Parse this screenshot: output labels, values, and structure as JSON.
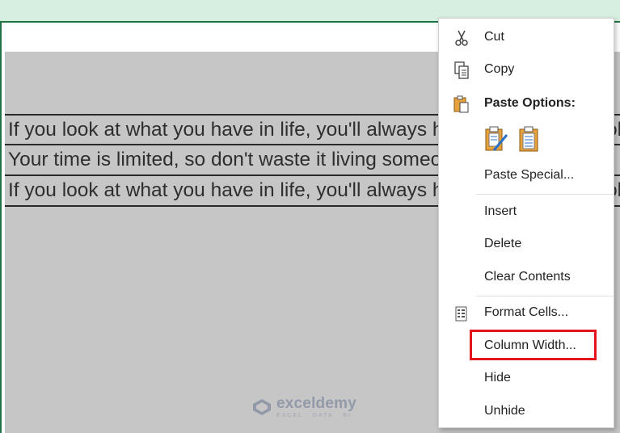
{
  "sheet": {
    "rows": [
      "If you look at what you have in life, you'll always have more. If you look at what you don't have",
      "Your time is limited, so don't waste it living someone else's life.",
      "If you look at what you have in life, you'll always have more. If you look at what you don't have"
    ]
  },
  "watermark": {
    "name": "exceldemy",
    "tagline": "EXCEL · DATA · BI"
  },
  "context_menu": {
    "items": {
      "cut": "Cut",
      "copy": "Copy",
      "paste_options": "Paste Options:",
      "paste_special": "Paste Special...",
      "insert": "Insert",
      "delete": "Delete",
      "clear_contents": "Clear Contents",
      "format_cells": "Format Cells...",
      "column_width": "Column Width...",
      "hide": "Hide",
      "unhide": "Unhide"
    }
  },
  "colors": {
    "excel_green": "#217346",
    "selection_gray": "#c6c6c6",
    "highlight_red": "#e3141b",
    "icon_orange": "#e8a23b",
    "icon_blue": "#2b73c8"
  }
}
